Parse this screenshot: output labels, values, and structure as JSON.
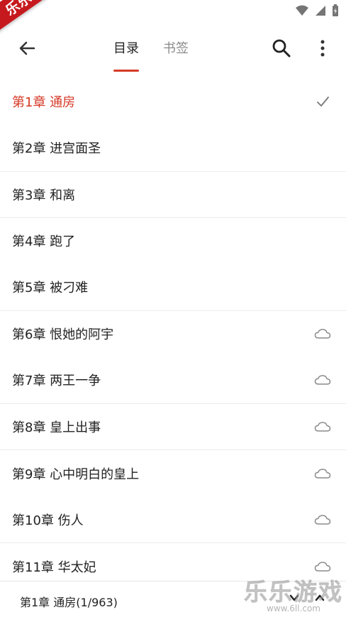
{
  "ribbon": {
    "text": "乐乐亲测"
  },
  "appbar": {
    "tabs": [
      {
        "label": "目录"
      },
      {
        "label": "书签"
      }
    ]
  },
  "chapters": [
    {
      "title": "第1章 通房"
    },
    {
      "title": "第2章 进宫面圣"
    },
    {
      "title": "第3章 和离"
    },
    {
      "title": "第4章 跑了"
    },
    {
      "title": "第5章 被刁难"
    },
    {
      "title": "第6章 恨她的阿宇"
    },
    {
      "title": "第7章 两王一争"
    },
    {
      "title": "第8章 皇上出事"
    },
    {
      "title": "第9章 心中明白的皇上"
    },
    {
      "title": "第10章 伤人"
    },
    {
      "title": "第11章 华太妃"
    }
  ],
  "bottombar": {
    "progress": "第1章 通房(1/963)"
  },
  "watermark": {
    "title": "乐乐游戏",
    "url": "www.6ll.com"
  },
  "colors": {
    "accent": "#d53a27",
    "ribbon": "#c6191e",
    "text": "#222222",
    "muted": "#8a8a8a",
    "icon": "#7a7a7a"
  },
  "icons": [
    "wifi-icon",
    "signal-icon",
    "battery-icon",
    "back-arrow-icon",
    "search-icon",
    "more-vert-icon",
    "check-icon",
    "cloud-icon",
    "chevron-down-icon",
    "chevron-up-icon"
  ]
}
